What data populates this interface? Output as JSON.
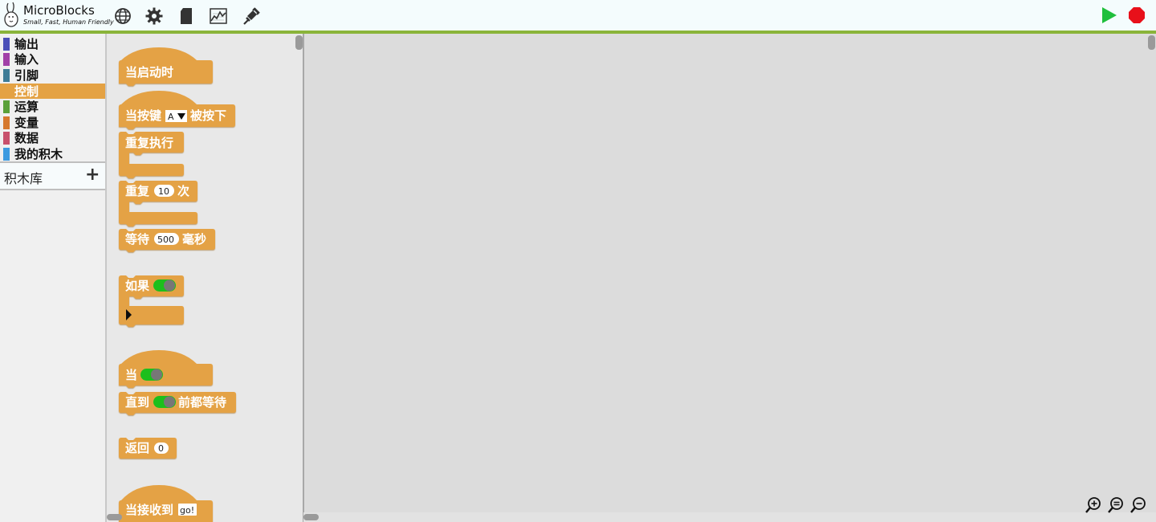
{
  "app": {
    "name": "MicroBlocks",
    "tagline": "Small, Fast, Human Friendly"
  },
  "toolbar": {
    "icons": [
      "globe-icon",
      "gear-icon",
      "file-icon",
      "graph-icon",
      "usb-plug-icon"
    ],
    "run_icon": "green-play-icon",
    "stop_icon": "red-stop-icon"
  },
  "categories": [
    {
      "label": "输出",
      "color": "#4a4fb8"
    },
    {
      "label": "输入",
      "color": "#a140a8"
    },
    {
      "label": "引脚",
      "color": "#3e7b96"
    },
    {
      "label": "控制",
      "color": "#e4a244",
      "active": true
    },
    {
      "label": "运算",
      "color": "#5aa13a"
    },
    {
      "label": "变量",
      "color": "#d6792f"
    },
    {
      "label": "数据",
      "color": "#c8506c"
    },
    {
      "label": "我的积木",
      "color": "#3c9ae0"
    }
  ],
  "library": {
    "label": "积木库",
    "add": "+"
  },
  "blocks": {
    "when_started": "当启动时",
    "when_button_prefix": "当按键",
    "when_button_key": "A",
    "when_button_suffix": "被按下",
    "forever": "重复执行",
    "repeat_prefix": "重复",
    "repeat_count": "10",
    "repeat_suffix": "次",
    "wait_prefix": "等待",
    "wait_ms": "500",
    "wait_suffix": "毫秒",
    "if": "如果",
    "when_condition": "当",
    "wait_until_prefix": "直到",
    "wait_until_suffix": "前都等待",
    "return": "返回",
    "return_value": "0",
    "when_receive": "当接收到",
    "when_receive_msg": "go!"
  },
  "colors": {
    "control": "#e4a244",
    "accent_green": "#8ab43a",
    "run": "#1fbf3c",
    "stop": "#e8101a"
  }
}
